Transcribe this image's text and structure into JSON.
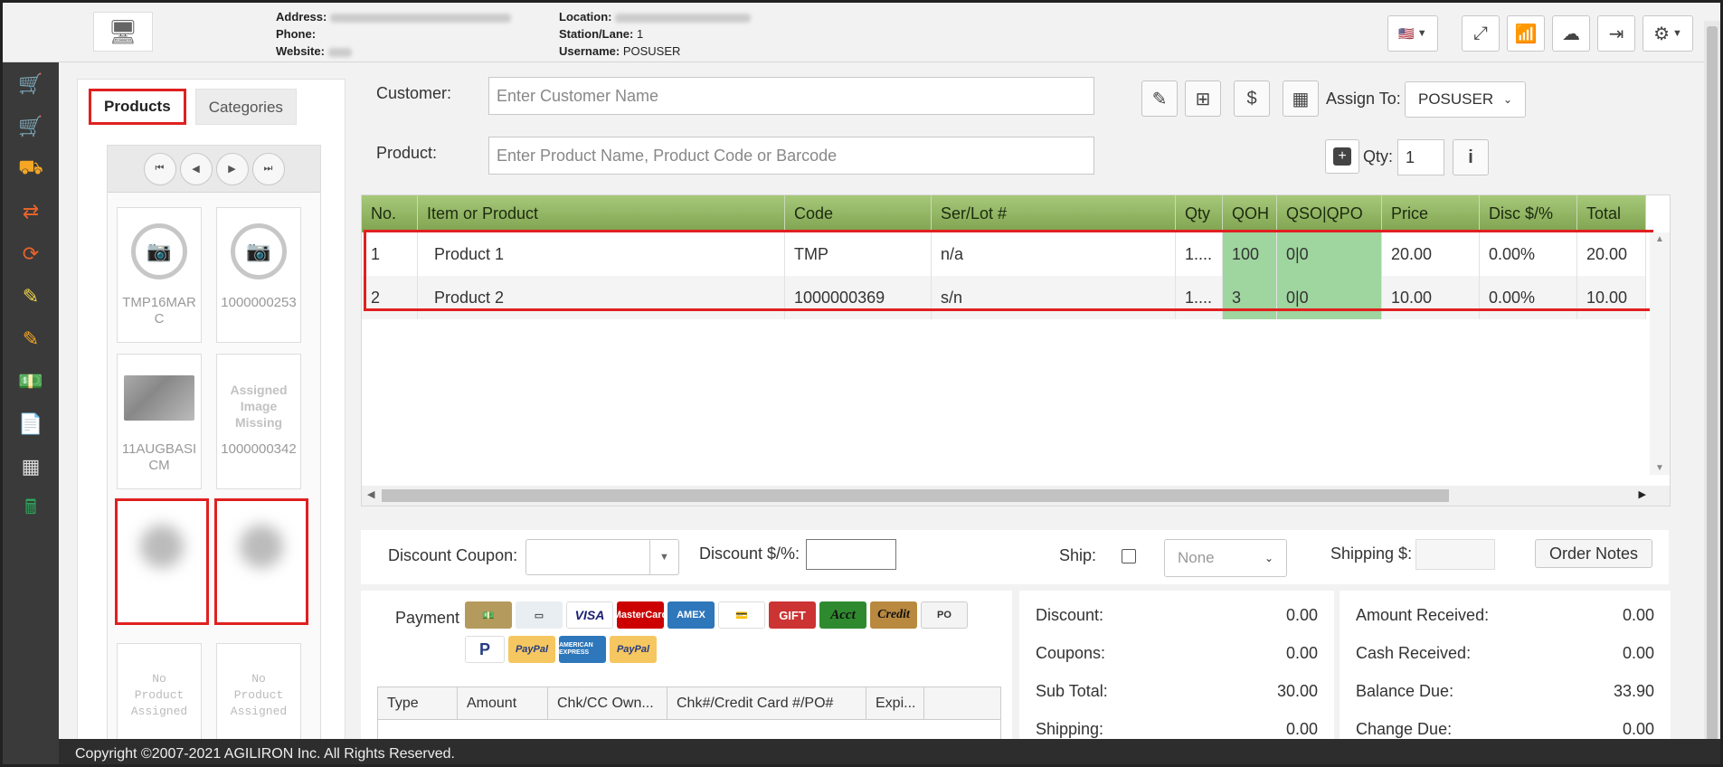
{
  "header": {
    "address_label": "Address:",
    "phone_label": "Phone:",
    "website_label": "Website:",
    "location_label": "Location:",
    "station_label": "Station/Lane:",
    "station_value": "1",
    "username_label": "Username:",
    "username_value": "POSUSER",
    "address_value": "Fulfillment by Amazon FBA, NV 89042",
    "location_value": "DontRemovePOSChannel"
  },
  "nav_icons": [
    "cart-icon",
    "cart-icon",
    "cart-outline-icon",
    "transfer-icon",
    "refresh-icon",
    "edit-icon",
    "edit-icon",
    "money-icon",
    "document-icon",
    "table-icon",
    "cash-register-icon"
  ],
  "nav_colors": [
    "#7cc142",
    "#f5a623",
    "#f5a623",
    "#e8632b",
    "#e8632b",
    "#f0d54a",
    "#f5a623",
    "#29a8d4",
    "#9b6fd6",
    "#dddddd",
    "#2fa35b"
  ],
  "products_panel": {
    "tab_products": "Products",
    "tab_categories": "Categories",
    "tiles": [
      {
        "label": "TMP16MARC",
        "kind": "nocam"
      },
      {
        "label": "1000000253",
        "kind": "nocam"
      },
      {
        "label": "11AUGBASICM",
        "kind": "photo"
      },
      {
        "label": "1000000342",
        "kind": "missing",
        "missing_text": "Assigned Image Missing"
      },
      {
        "label": "",
        "kind": "blur"
      },
      {
        "label": "",
        "kind": "blur"
      },
      {
        "label": "",
        "kind": "noprod",
        "missing_text": "No Product Assigned"
      },
      {
        "label": "",
        "kind": "noprod",
        "missing_text": "No Product Assigned"
      }
    ]
  },
  "form": {
    "customer_label": "Customer:",
    "customer_placeholder": "Enter Customer Name",
    "product_label": "Product:",
    "product_placeholder": "Enter Product Name, Product Code or Barcode",
    "assign_label": "Assign To:",
    "assign_value": "POSUSER",
    "qty_label": "Qty:",
    "qty_value": "1"
  },
  "grid": {
    "columns": [
      "No.",
      "Item or Product",
      "Code",
      "Ser/Lot #",
      "Qty",
      "QOH",
      "QSO|QPO",
      "Price",
      "Disc $/%",
      "Total"
    ],
    "rows": [
      [
        "1",
        "Product 1",
        "TMP",
        "n/a",
        "1....",
        "100",
        "0|0",
        "20.00",
        "0.00%",
        "20.00"
      ],
      [
        "2",
        "Product 2",
        "1000000369",
        "s/n",
        "1....",
        "3",
        "0|0",
        "10.00",
        "0.00%",
        "10.00"
      ]
    ]
  },
  "discount_bar": {
    "coupon_label": "Discount Coupon:",
    "discount_label": "Discount $/%:",
    "ship_label": "Ship:",
    "ship_select": "None",
    "shipping_label": "Shipping $:",
    "order_notes": "Order Notes"
  },
  "payment": {
    "label": "Payment",
    "methods": [
      "Cash",
      "Check",
      "VISA",
      "MasterCard",
      "AMEX",
      "Card",
      "GIFT",
      "Acct",
      "Credit",
      "PO",
      "PayPal",
      "PayPal",
      "AMERICAN EXPRESS",
      "PayPal"
    ],
    "columns": [
      "Type",
      "Amount",
      "Chk/CC Own...",
      "Chk#/Credit Card #/PO#",
      "Expi..."
    ]
  },
  "totals_left": [
    {
      "label": "Discount:",
      "value": "0.00"
    },
    {
      "label": "Coupons:",
      "value": "0.00"
    },
    {
      "label": "Sub Total:",
      "value": "30.00"
    },
    {
      "label": "Shipping:",
      "value": "0.00"
    }
  ],
  "totals_right": [
    {
      "label": "Amount Received:",
      "value": "0.00"
    },
    {
      "label": "Cash Received:",
      "value": "0.00"
    },
    {
      "label": "Balance Due:",
      "value": "33.90"
    },
    {
      "label": "Change Due:",
      "value": "0.00"
    }
  ],
  "footer": "Copyright ©2007-2021 AGILIRON Inc. All Rights Reserved."
}
